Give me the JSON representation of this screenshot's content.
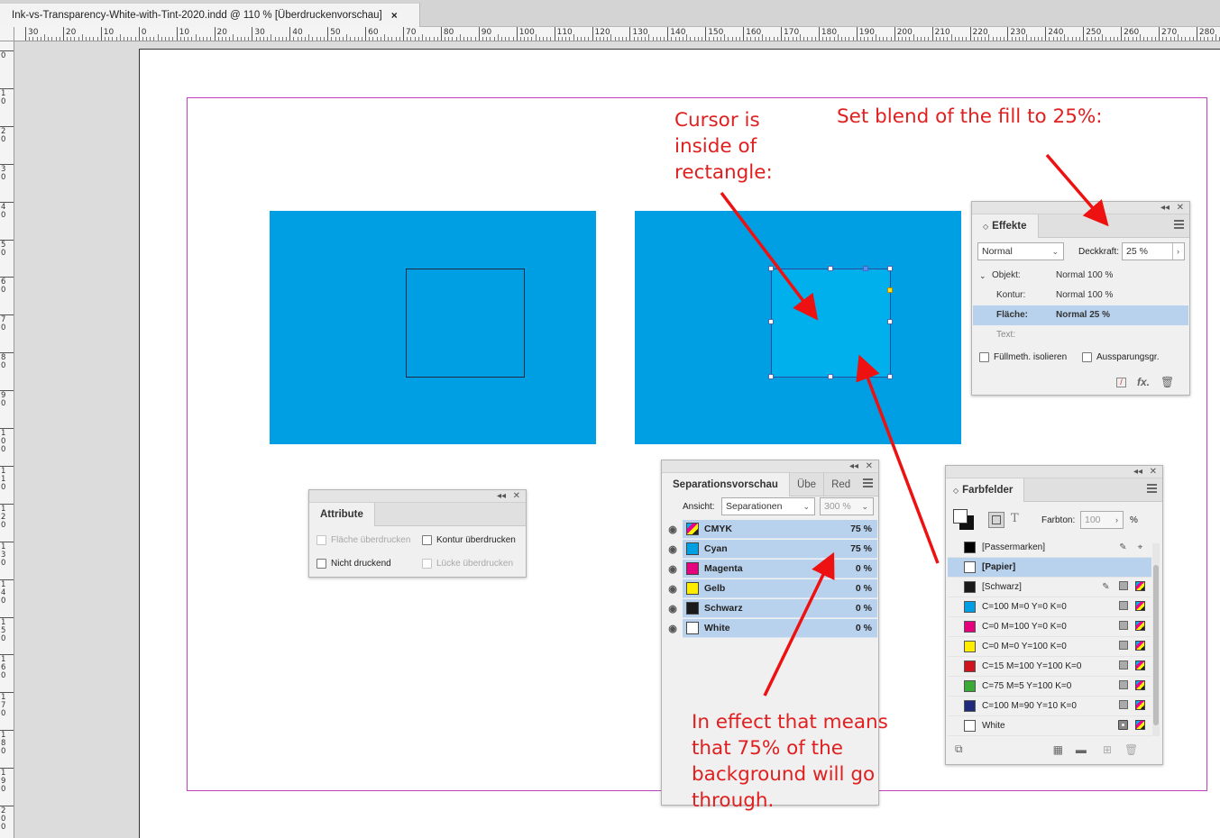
{
  "document_tab": {
    "title": "Ink-vs-Transparency-White-with-Tint-2020.indd @ 110 % [Überdruckenvorschau]",
    "close": "×"
  },
  "ruler": {
    "top_labels": [
      "30",
      "20",
      "10",
      "0",
      "10",
      "20",
      "30",
      "40",
      "50",
      "60",
      "70",
      "80",
      "90",
      "100",
      "110",
      "120",
      "130",
      "140",
      "150",
      "160",
      "170",
      "180",
      "190",
      "200",
      "210",
      "220",
      "230",
      "240",
      "250",
      "260",
      "270",
      "280"
    ],
    "left_labels": [
      "0",
      "10",
      "20",
      "30",
      "40",
      "50",
      "60",
      "70",
      "80",
      "90",
      "100",
      "110",
      "120",
      "130",
      "140",
      "150",
      "160",
      "170",
      "180",
      "190",
      "200"
    ]
  },
  "annotations": {
    "cursor_note": "Cursor is\ninside of\nrectangle:",
    "blend_note": "Set blend of the fill to 25%:",
    "effect_note": "In effect that means\nthat 75% of the\nbackground will go\nthrough."
  },
  "effekte": {
    "tab": "Effekte",
    "blend_mode": "Normal",
    "opacity_label": "Deckkraft:",
    "opacity_value": "25 %",
    "rows": [
      {
        "label": "Objekt:",
        "value": "Normal 100 %"
      },
      {
        "label": "Kontur:",
        "value": "Normal 100 %"
      },
      {
        "label": "Fläche:",
        "value": "Normal 25 %"
      },
      {
        "label": "Text:",
        "value": ""
      }
    ],
    "isolate": "Füllmeth. isolieren",
    "knockout": "Aussparungsgr."
  },
  "attribute": {
    "tab": "Attribute",
    "fill_overprint": "Fläche überdrucken",
    "stroke_overprint": "Kontur überdrucken",
    "nonprinting": "Nicht druckend",
    "gap_overprint": "Lücke überdrucken"
  },
  "separations": {
    "tab_active": "Separationsvorschau",
    "tab_2": "Übe",
    "tab_3": "Red",
    "view_label": "Ansicht:",
    "view_value": "Separationen",
    "zoom_value": "300 %",
    "inks": [
      {
        "name": "CMYK",
        "percent": "75 %",
        "color": "cmyk"
      },
      {
        "name": "Cyan",
        "percent": "75 %",
        "color": "#00a0e3"
      },
      {
        "name": "Magenta",
        "percent": "0 %",
        "color": "#e5007d"
      },
      {
        "name": "Gelb",
        "percent": "0 %",
        "color": "#ffed00"
      },
      {
        "name": "Schwarz",
        "percent": "0 %",
        "color": "#1a1a1a"
      },
      {
        "name": "White",
        "percent": "0 %",
        "color": "#ffffff"
      }
    ]
  },
  "swatches": {
    "tab": "Farbfelder",
    "tint_label": "Farbton:",
    "tint_value": "100",
    "tint_unit": "%",
    "items": [
      {
        "name": "[Passermarken]",
        "color": "#000000",
        "bold": false
      },
      {
        "name": "[Papier]",
        "color": "#ffffff",
        "bold": true
      },
      {
        "name": "[Schwarz]",
        "color": "#1a1a1a",
        "bold": false
      },
      {
        "name": "C=100 M=0 Y=0 K=0",
        "color": "#009fe3",
        "bold": false
      },
      {
        "name": "C=0 M=100 Y=0 K=0",
        "color": "#e5007d",
        "bold": false
      },
      {
        "name": "C=0 M=0 Y=100 K=0",
        "color": "#ffed00",
        "bold": false
      },
      {
        "name": "C=15 M=100 Y=100 K=0",
        "color": "#d0141e",
        "bold": false
      },
      {
        "name": "C=75 M=5 Y=100 K=0",
        "color": "#3aa935",
        "bold": false
      },
      {
        "name": "C=100 M=90 Y=10 K=0",
        "color": "#1f2a7a",
        "bold": false
      },
      {
        "name": "White",
        "color": "#ffffff",
        "bold": false
      }
    ]
  },
  "colors": {
    "cyan_fill": "#009fe3",
    "annotation_red": "#e02020",
    "selection_blue": "#b8d2ee"
  }
}
